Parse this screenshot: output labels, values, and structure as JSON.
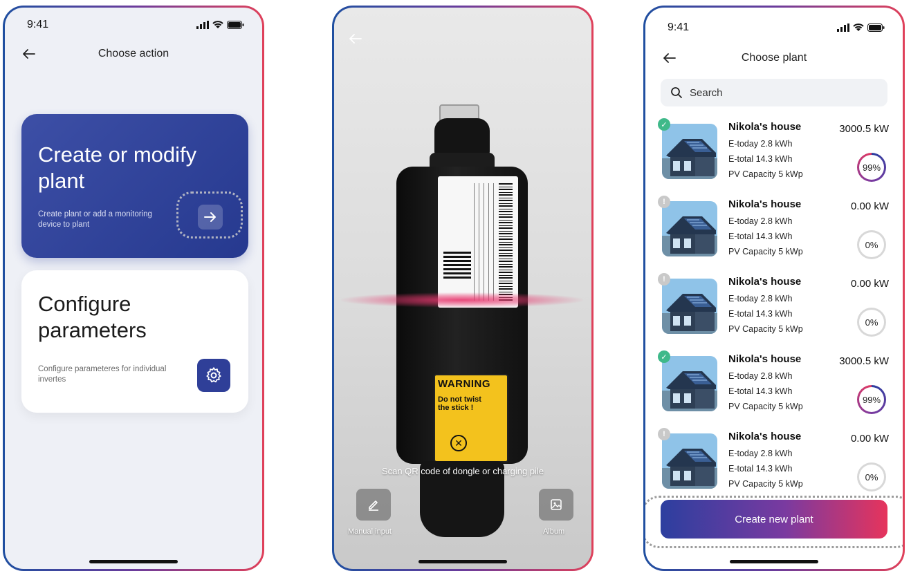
{
  "status_time": "9:41",
  "screen1": {
    "title": "Choose action",
    "create_card": {
      "title": "Create or modify plant",
      "description": "Create plant or add a monitoring device to plant"
    },
    "configure_card": {
      "title": "Configure parameters",
      "description": "Configure parameteres for individual invertes"
    }
  },
  "screen2": {
    "scan_caption": "Scan QR code of dongle or charging pile",
    "manual_input_label": "Manual input",
    "album_label": "Album",
    "warning_title": "WARNING",
    "warning_text": "Do not twist the stick !"
  },
  "screen3": {
    "title": "Choose plant",
    "search_placeholder": "Search",
    "plants": [
      {
        "name": "Nikola's house",
        "power": "3000.5 kW",
        "e_today": "E-today 2.8 kWh",
        "e_total": "E-total 14.3 kWh",
        "pv_capacity": "PV Capacity  5 kWp",
        "percent": "99%",
        "status": "ok"
      },
      {
        "name": "Nikola's house",
        "power": "0.00 kW",
        "e_today": "E-today 2.8 kWh",
        "e_total": "E-total 14.3 kWh",
        "pv_capacity": "PV Capacity  5 kWp",
        "percent": "0%",
        "status": "warn"
      },
      {
        "name": "Nikola's house",
        "power": "0.00 kW",
        "e_today": "E-today 2.8 kWh",
        "e_total": "E-total 14.3 kWh",
        "pv_capacity": "PV Capacity  5 kWp",
        "percent": "0%",
        "status": "warn"
      },
      {
        "name": "Nikola's house",
        "power": "3000.5 kW",
        "e_today": "E-today 2.8 kWh",
        "e_total": "E-total 14.3 kWh",
        "pv_capacity": "PV Capacity  5 kWp",
        "percent": "99%",
        "status": "ok"
      },
      {
        "name": "Nikola's house",
        "power": "0.00 kW",
        "e_today": "E-today 2.8 kWh",
        "e_total": "E-total 14.3 kWh",
        "pv_capacity": "PV Capacity  5 kWp",
        "percent": "0%",
        "status": "warn"
      }
    ],
    "create_button": "Create new plant"
  },
  "colors": {
    "primary_blue": "#2f3f98",
    "accent_pink": "#e6345c",
    "success_green": "#3fb98a"
  },
  "icons": [
    "back-arrow-icon",
    "signal-icon",
    "wifi-icon",
    "battery-icon",
    "arrow-right-icon",
    "gear-icon",
    "pencil-icon",
    "image-icon",
    "search-icon",
    "check-icon",
    "exclamation-icon"
  ]
}
